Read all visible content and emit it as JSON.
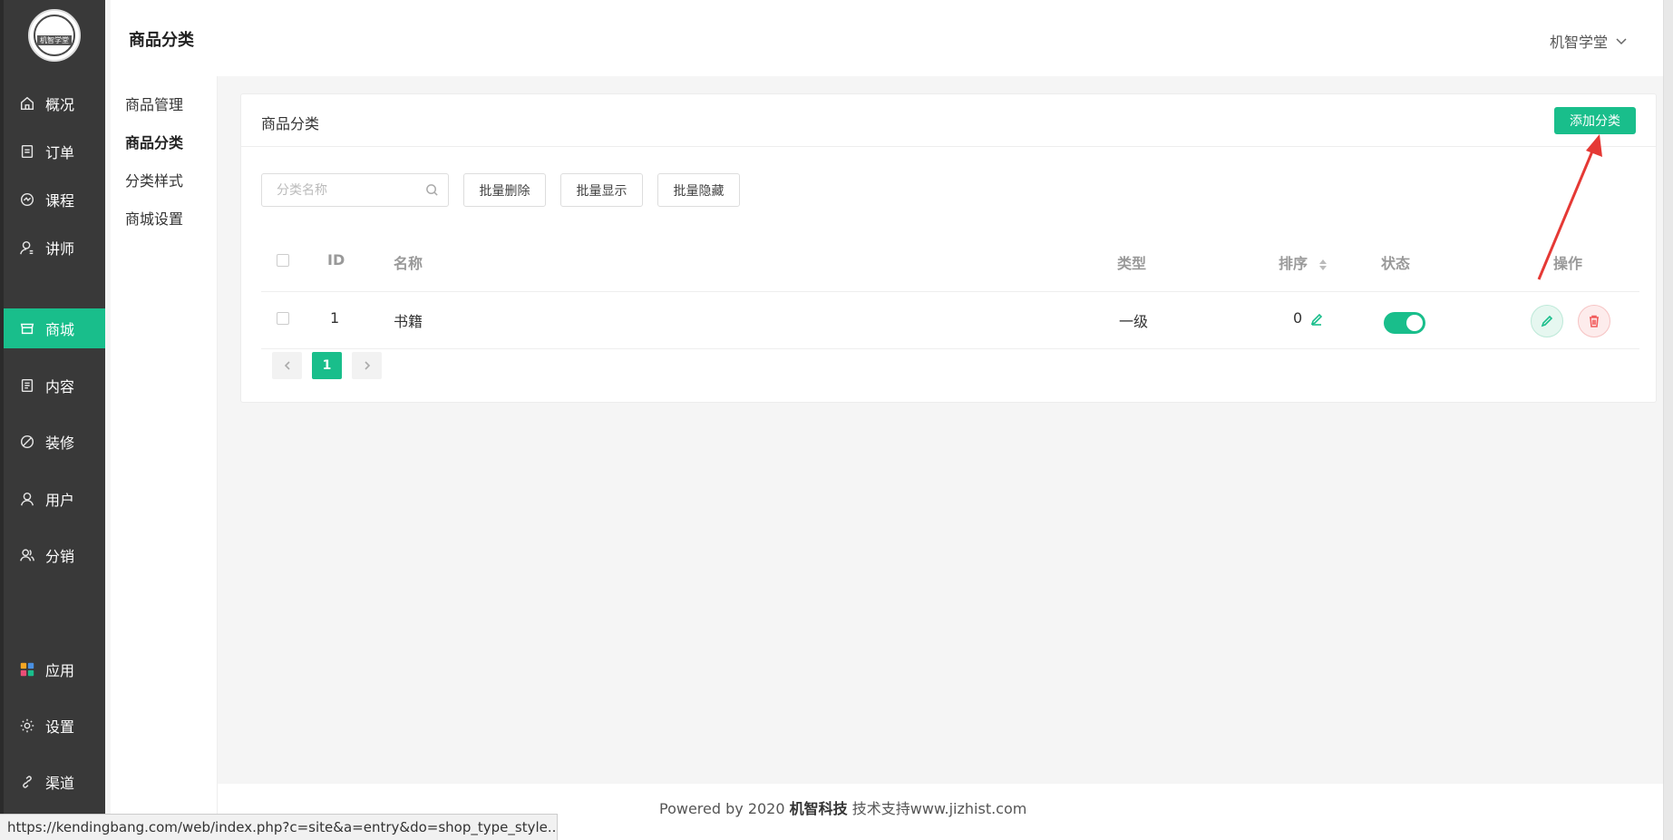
{
  "sidebar": {
    "logo_text": "机智学堂",
    "items": [
      {
        "label": "概况",
        "icon": "home-icon"
      },
      {
        "label": "订单",
        "icon": "order-icon"
      },
      {
        "label": "课程",
        "icon": "course-icon"
      },
      {
        "label": "讲师",
        "icon": "teacher-icon"
      },
      {
        "label": "商城",
        "icon": "shop-icon",
        "active": true
      },
      {
        "label": "内容",
        "icon": "content-icon"
      },
      {
        "label": "装修",
        "icon": "decorate-icon"
      },
      {
        "label": "用户",
        "icon": "user-icon"
      },
      {
        "label": "分销",
        "icon": "distribution-icon"
      },
      {
        "label": "应用",
        "icon": "apps-icon"
      },
      {
        "label": "设置",
        "icon": "gear-icon"
      },
      {
        "label": "渠道",
        "icon": "link-icon"
      }
    ]
  },
  "subnav": {
    "items": [
      {
        "label": "商品管理"
      },
      {
        "label": "商品分类",
        "active": true
      },
      {
        "label": "分类样式"
      },
      {
        "label": "商城设置"
      }
    ]
  },
  "header": {
    "title": "商品分类",
    "user": "机智学堂"
  },
  "card": {
    "title": "商品分类",
    "add_button": "添加分类",
    "search_placeholder": "分类名称",
    "tools": [
      "批量删除",
      "批量显示",
      "批量隐藏"
    ]
  },
  "table": {
    "columns": {
      "id": "ID",
      "name": "名称",
      "type": "类型",
      "sort": "排序",
      "status": "状态",
      "ops": "操作"
    },
    "rows": [
      {
        "id": "1",
        "name": "书籍",
        "type": "一级",
        "sort": "0",
        "status_on": true
      }
    ]
  },
  "pagination": {
    "current": "1"
  },
  "footer": {
    "prefix": "Powered by 2020 ",
    "brand": "机智科技",
    "suffix": " 技术支持www.jizhist.com"
  },
  "status_bar": {
    "url": "https://kendingbang.com/web/index.php?c=site&a=entry&do=shop_type_style..."
  },
  "colors": {
    "accent": "#19be8b",
    "sidebar": "#393939",
    "arrow": "#e53935"
  }
}
